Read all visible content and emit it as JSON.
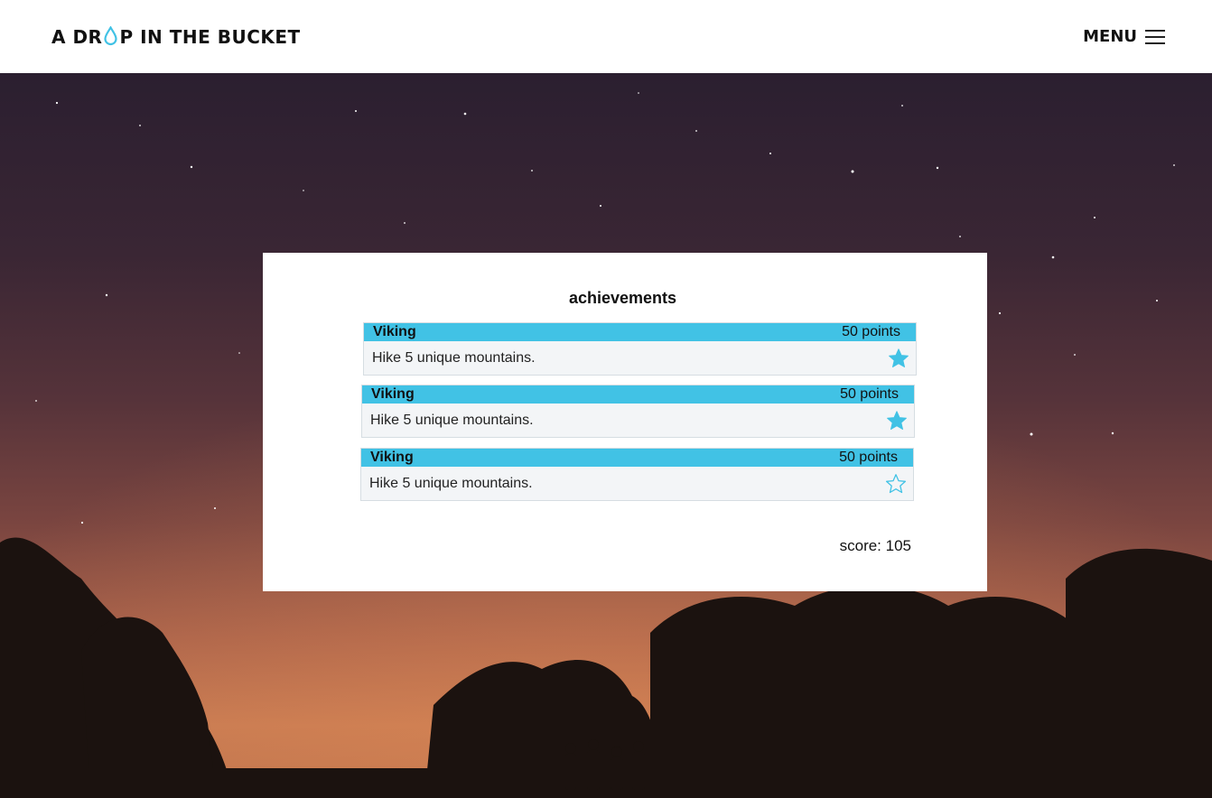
{
  "header": {
    "logo_part1": "A DR",
    "logo_part2": "P IN THE BUCKET",
    "menu_label": "MENU"
  },
  "card": {
    "title": "achievements",
    "achievements": [
      {
        "name": "Viking",
        "points": "50 points",
        "description": "Hike 5 unique mountains.",
        "completed": true
      },
      {
        "name": "Viking",
        "points": "50 points",
        "description": "Hike 5 unique mountains.",
        "completed": true
      },
      {
        "name": "Viking",
        "points": "50 points",
        "description": "Hike 5 unique mountains.",
        "completed": false
      }
    ],
    "score": "score: 105"
  },
  "colors": {
    "accent": "#41c2e5",
    "header_bg": "#ffffff"
  },
  "icons": {
    "logo_drop": "water-drop-icon",
    "menu": "hamburger-menu-icon",
    "completed": "star-filled-icon",
    "pending": "star-outline-icon"
  }
}
